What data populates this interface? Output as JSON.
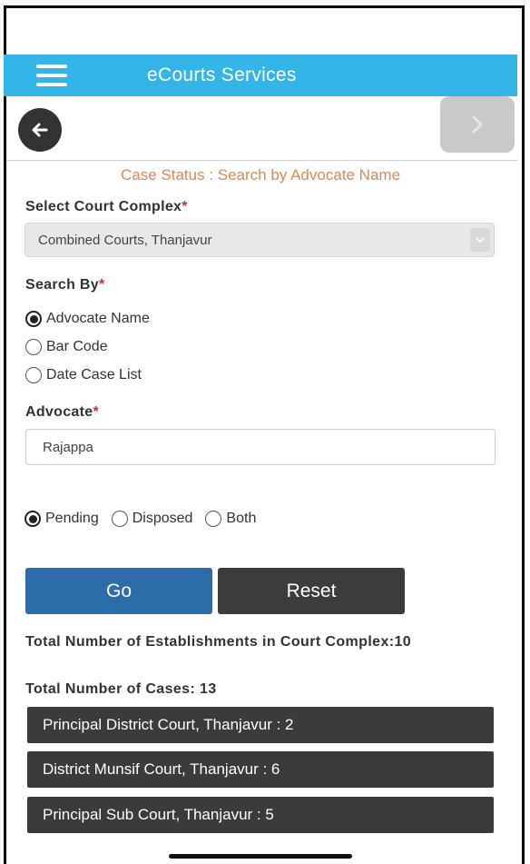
{
  "header": {
    "title": "eCourts Services"
  },
  "page_title": "Case Status : Search by Advocate Name",
  "court_complex": {
    "label": "Select Court Complex",
    "required_mark": "*",
    "selected": "Combined Courts, Thanjavur"
  },
  "search_by": {
    "label": "Search By",
    "required_mark": "*",
    "options": [
      {
        "label": "Advocate Name",
        "checked": true
      },
      {
        "label": "Bar Code",
        "checked": false
      },
      {
        "label": "Date Case List",
        "checked": false
      }
    ]
  },
  "advocate": {
    "label": "Advocate",
    "required_mark": "*",
    "value": "Rajappa"
  },
  "case_status": {
    "options": [
      {
        "label": "Pending",
        "checked": true
      },
      {
        "label": "Disposed",
        "checked": false
      },
      {
        "label": "Both",
        "checked": false
      }
    ]
  },
  "buttons": {
    "go": "Go",
    "reset": "Reset"
  },
  "summary": {
    "establishments": "Total Number of Establishments in Court Complex:10",
    "cases": "Total Number of Cases: 13"
  },
  "courts": [
    "Principal District Court, Thanjavur : 2",
    "District Munsif Court, Thanjavur : 6",
    "Principal Sub Court, Thanjavur : 5"
  ],
  "colors": {
    "header_bar": "#33b5e8",
    "page_title": "#e08852",
    "go_button": "#2c6ca8",
    "reset_button": "#3c3c3c",
    "court_item": "#3b3b3b"
  }
}
